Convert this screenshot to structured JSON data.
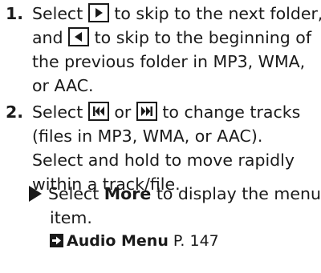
{
  "step1": {
    "number": "1.",
    "l1_pre": "Select",
    "l1_post": "to skip to the next folder,",
    "l2_pre": "and",
    "l2_post": "to skip to the beginning of",
    "l3": "the previous folder in MP3, WMA,",
    "l4": "or AAC.",
    "icon_next_folder": "play-right-icon",
    "icon_prev_folder": "play-left-icon"
  },
  "step2": {
    "number": "2.",
    "l1_pre": "Select",
    "l1_mid": "or",
    "l1_post": "to change tracks",
    "l2": "(files in MP3, WMA, or AAC).",
    "l3": "Select and hold to move rapidly",
    "l4": "within a track/file.",
    "icon_skip_back": "skip-back-icon",
    "icon_skip_forward": "skip-forward-icon"
  },
  "note": {
    "pre": "Select",
    "bold": "More",
    "post": "to display the menu",
    "l2": "item.",
    "xref_title": "Audio Menu",
    "xref_page": "P. 147",
    "bullet_icon": "triangle-bullet-icon",
    "xref_icon": "cross-reference-arrow-icon"
  }
}
